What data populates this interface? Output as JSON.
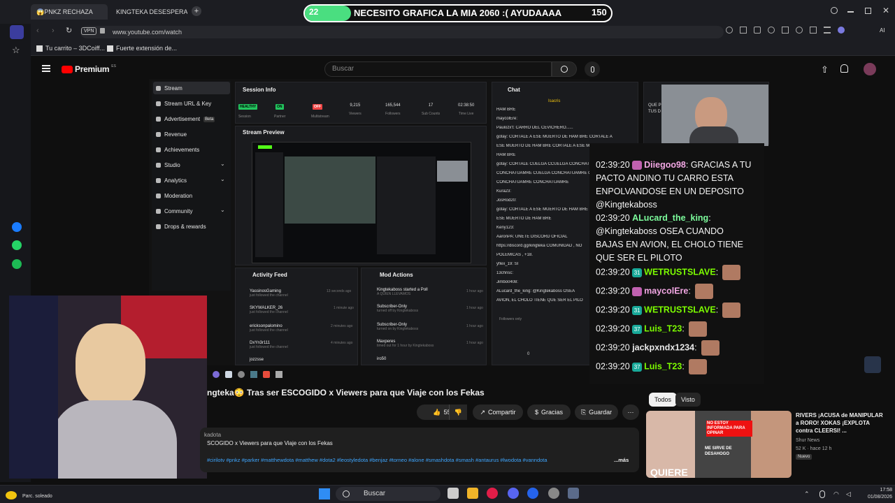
{
  "browser": {
    "tabs": [
      {
        "label": "😱PNKZ RECHAZA"
      },
      {
        "label": "KINGTEKA DESESPERADO"
      }
    ],
    "vpn_label": "VPN",
    "url": "www.youtube.com/watch",
    "ai_label": "AI",
    "bookmarks": [
      {
        "label": "Tu carrito – 3DCoiff..."
      },
      {
        "label": "Fuerte extensión de..."
      }
    ]
  },
  "overlay_banner": {
    "left_count": "22",
    "title": "NECESITO GRAFICA LA MIA 2060 :( AYUDAAAA",
    "right_count": "150",
    "progress_fraction": 0.15
  },
  "youtube": {
    "logo_text": "Premium",
    "logo_region": "ES",
    "search_placeholder": "Buscar",
    "video_title": "ngteka😳 Tras ser ESCOGIDO x Viewers para que Viaje con los Fekas",
    "like_count": "55",
    "actions": {
      "share": "Compartir",
      "thanks": "Gracias",
      "save": "Guardar"
    },
    "description": {
      "channel_fragment": "kadota",
      "line": "SCOGIDO x Viewers para que Viaje con los Fekas",
      "hashtags": "#cirilotv #pnkz #parker #matthewdota #matthew #dota2 #leostyledota #benjaz #torneo #alone #smashdota #smash #antaurus #lwodota #vanndota",
      "more": "...más"
    },
    "chips": [
      {
        "label": "Todos"
      },
      {
        "label": "Visto"
      }
    ],
    "recommended": {
      "title": "RIVERS ¡ACUSA de MANIPULAR a RORO! XOKAS ¡EXPLOTA contra CLEERSI! ...",
      "channel": "Shur News",
      "meta": "52 K · hace 12 h",
      "badge": "Nuevo",
      "thumb_text_1": "NO ESTOY INFORMADA PARA OPINAR",
      "thumb_text_2": "ME SIRVE DE DESAHOGO",
      "thumb_text_3": "QUIERE"
    }
  },
  "kick_dashboard": {
    "sidebar": [
      {
        "label": "Stream"
      },
      {
        "label": "Stream URL & Key"
      },
      {
        "label": "Advertisement",
        "badge": "Beta"
      },
      {
        "label": "Revenue"
      },
      {
        "label": "Achievements"
      },
      {
        "label": "Studio"
      },
      {
        "label": "Analytics"
      },
      {
        "label": "Moderation"
      },
      {
        "label": "Community"
      },
      {
        "label": "Drops & rewards"
      }
    ],
    "session_info": {
      "title": "Session Info",
      "healthy": "HEALTHY",
      "healthy_label": "Session",
      "partner": "ON",
      "partner_label": "Partner",
      "multistream": "OFF",
      "multistream_label": "Multistream",
      "viewers": "9,215",
      "viewers_label": "Viewers",
      "followers": "165,544",
      "followers_label": "Followers",
      "subs": "17",
      "subs_label": "Sub Counts",
      "time": "02:38:50",
      "time_label": "Time Live"
    },
    "stream_preview_title": "Stream Preview",
    "activity_feed": {
      "title": "Activity Feed",
      "rows": [
        {
          "user": "YassinosGaming",
          "action": "just followed the channel",
          "time": "13 seconds ago"
        },
        {
          "user": "SKYWALKER_26",
          "action": "just followed the channel",
          "time": "1 minute ago"
        },
        {
          "user": "ericksonpalomino",
          "action": "just followed the channel",
          "time": "2 minutes ago"
        },
        {
          "user": "DxYn3r111",
          "action": "just followed the channel",
          "time": "4 minutes ago"
        },
        {
          "user": "jozzsse",
          "action": "",
          "time": ""
        }
      ]
    },
    "mod_actions": {
      "title": "Mod Actions",
      "rows": [
        {
          "main": "Kingtekaboss started a Poll",
          "sub": "A QUIEN LLEVAMOS",
          "time": "1 hour ago"
        },
        {
          "main": "Subscriber-Only",
          "sub": "turned off by Kingtekaboss",
          "time": "1 hour ago"
        },
        {
          "main": "Subscriber-Only",
          "sub": "turned on by Kingtekaboss",
          "time": "1 hour ago"
        },
        {
          "main": "Maxperes",
          "sub": "timed out for 1 hour by Kingtekaboss",
          "time": "1 hour ago"
        },
        {
          "main": "iro50",
          "sub": "",
          "time": ""
        }
      ]
    },
    "chat": {
      "title": "Chat",
      "pinned": "Isacris",
      "lines": [
        "HAM BRE",
        "maycolEre:",
        "Paulozx't: CARRO DEL CEVICHERO......",
        "gotay: CORTALE A ESE MUERTO DE HAM BRE  CORTALE A",
        "ESE MUERTO DE HAM BRE  CORTALE A ESE MUERTO DE",
        "HAM BRE",
        "gotay: CORTALE CUELGA CCUELGA CONCHATUAMRE",
        "CONCHATUAMRE CUELGA CONCHATUAMRE CUELGA",
        "CONCHATUAMRE CONCHATUAMRE",
        "Kura23:",
        "JosRod20:",
        "gotay: CORTALE A ESE MUERTO DE HAM BRE",
        "ESE MUERTO DE HAM BRE",
        "Keny123:",
        "AaronPA: UNETE DISCORD OFICIAL",
        "https://discord.gg/kingteka COMUNIDAD , NO",
        "POLEMICAS , +18.",
        "yflex_19: SI",
        "13chrisc:",
        "Jimbo0408:",
        "ALucard_the_king: @Kingtekaboss OSEA",
        "AVION, EL CHOLO TIENE QUE SER EL PILO"
      ],
      "followers_only": "Followers only",
      "footer_count": "0"
    },
    "extra_panel": {
      "line1": "QUE P",
      "line2": "TUS D"
    }
  },
  "big_chat": [
    {
      "time": "02:39:20",
      "user": "Diiegoo98",
      "msg": "GRACIAS A TU",
      "badge": "pink"
    },
    {
      "cont": "PACTO ANDINO TU CARRO ESTA"
    },
    {
      "cont": "ENPOLVANDOSE EN UN DEPOSITO"
    },
    {
      "cont": "@Kingtekaboss"
    },
    {
      "time": "02:39:20",
      "user": "ALucard_the_king",
      "msg": ":"
    },
    {
      "cont": "@Kingtekaboss OSEA CUANDO"
    },
    {
      "cont": "BAJAS EN AVION, EL CHOLO TIENE"
    },
    {
      "cont": "QUE SER EL PILOTO"
    },
    {
      "time": "02:39:20",
      "user": "WETRUSTSLAVE",
      "msg": ":",
      "badge": "31",
      "emote": true
    },
    {
      "time": "02:39:20",
      "user": "maycolEre",
      "msg": ":",
      "badge": "pink",
      "emote": true
    },
    {
      "time": "02:39:20",
      "user": "WETRUSTSLAVE",
      "msg": ":",
      "badge": "31",
      "emote": true
    },
    {
      "time": "02:39:20",
      "user": "Luis_T23",
      "msg": ":",
      "badge": "37",
      "emote": true
    },
    {
      "time": "02:39:20",
      "user": "jackpxndx1234",
      "msg": ":",
      "emote": true
    },
    {
      "time": "02:39:20",
      "user": "Luis_T23",
      "msg": ":",
      "badge": "37",
      "emote": true
    }
  ],
  "taskbar": {
    "weather": "Parc. soleado",
    "search": "Buscar",
    "time": "17:58",
    "date": "01/08/2026"
  },
  "colors": {
    "accent_green": "#53fc18",
    "healthy_green": "#22c55e",
    "off_red": "#ef4444",
    "yt_red": "#ff0000",
    "banner_progress": "#4ade80",
    "chat_pink": "#c061b0",
    "chat_teal": "#18a999",
    "chat_green": "#7cfc00"
  }
}
